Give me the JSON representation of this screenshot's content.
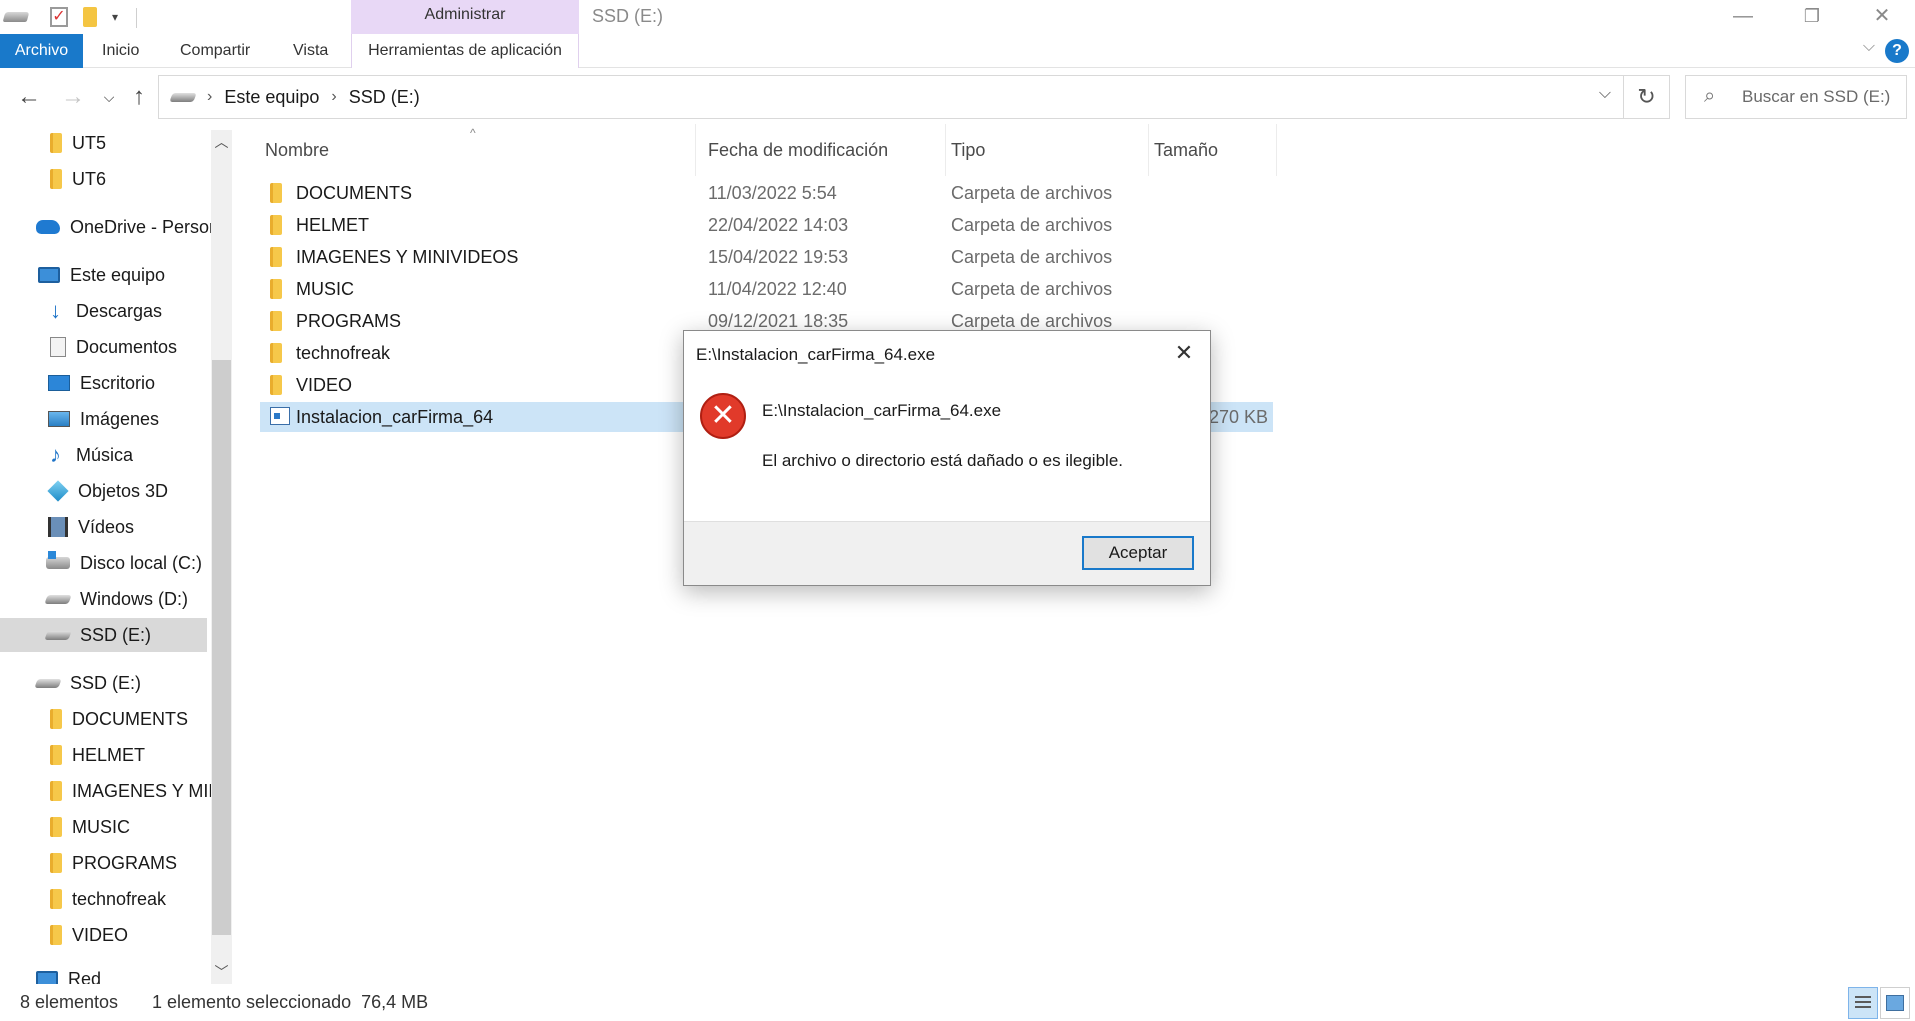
{
  "window": {
    "title": "SSD (E:)",
    "context_group": "Administrar",
    "minimize_icon": "minimize-icon",
    "maximize_icon": "restore-icon",
    "close_icon": "close-icon"
  },
  "ribbon": {
    "tabs": [
      {
        "label": "Archivo"
      },
      {
        "label": "Inicio"
      },
      {
        "label": "Compartir"
      },
      {
        "label": "Vista"
      },
      {
        "label": "Herramientas de aplicación"
      }
    ],
    "help_label": "?"
  },
  "address": {
    "crumbs": [
      "Este equipo",
      "SSD (E:)"
    ],
    "search_placeholder": "Buscar en SSD (E:)"
  },
  "nav": {
    "items": [
      {
        "label": "UT5",
        "icon": "folder-icon"
      },
      {
        "label": "UT6",
        "icon": "folder-icon"
      },
      {
        "label": "OneDrive - Personal",
        "icon": "cloud-icon"
      },
      {
        "label": "Este equipo",
        "icon": "pc-icon"
      },
      {
        "label": "Descargas",
        "icon": "download-icon"
      },
      {
        "label": "Documentos",
        "icon": "documents-icon"
      },
      {
        "label": "Escritorio",
        "icon": "desktop-icon"
      },
      {
        "label": "Imágenes",
        "icon": "images-icon"
      },
      {
        "label": "Música",
        "icon": "music-icon"
      },
      {
        "label": "Objetos 3D",
        "icon": "cube-icon"
      },
      {
        "label": "Vídeos",
        "icon": "video-icon"
      },
      {
        "label": "Disco local (C:)",
        "icon": "local-disk-icon"
      },
      {
        "label": "Windows (D:)",
        "icon": "drive-icon"
      },
      {
        "label": "SSD (E:)",
        "icon": "drive-icon"
      },
      {
        "label": "SSD (E:)",
        "icon": "drive-icon"
      },
      {
        "label": "DOCUMENTS",
        "icon": "folder-icon"
      },
      {
        "label": "HELMET",
        "icon": "folder-icon"
      },
      {
        "label": "IMAGENES Y MINIVIDEOS",
        "icon": "folder-icon"
      },
      {
        "label": "MUSIC",
        "icon": "folder-icon"
      },
      {
        "label": "PROGRAMS",
        "icon": "folder-icon"
      },
      {
        "label": "technofreak",
        "icon": "folder-icon"
      },
      {
        "label": "VIDEO",
        "icon": "folder-icon"
      },
      {
        "label": "Red",
        "icon": "network-icon"
      }
    ],
    "selected_index": 13
  },
  "files": {
    "columns": [
      "Nombre",
      "Fecha de modificación",
      "Tipo",
      "Tamaño"
    ],
    "rows": [
      {
        "name": "DOCUMENTS",
        "date": "11/03/2022 5:54",
        "type": "Carpeta de archivos",
        "size": "",
        "icon": "folder-icon"
      },
      {
        "name": "HELMET",
        "date": "22/04/2022 14:03",
        "type": "Carpeta de archivos",
        "size": "",
        "icon": "folder-icon"
      },
      {
        "name": "IMAGENES Y MINIVIDEOS",
        "date": "15/04/2022 19:53",
        "type": "Carpeta de archivos",
        "size": "",
        "icon": "folder-icon"
      },
      {
        "name": "MUSIC",
        "date": "11/04/2022 12:40",
        "type": "Carpeta de archivos",
        "size": "",
        "icon": "folder-icon"
      },
      {
        "name": "PROGRAMS",
        "date": "09/12/2021 18:35",
        "type": "Carpeta de archivos",
        "size": "",
        "icon": "folder-icon"
      },
      {
        "name": "technofreak",
        "date": "",
        "type": "",
        "size": "",
        "icon": "folder-icon"
      },
      {
        "name": "VIDEO",
        "date": "",
        "type": "",
        "size": "",
        "icon": "folder-icon"
      },
      {
        "name": "Instalacion_carFirma_64",
        "date": "",
        "type": "",
        "size": "270 KB",
        "icon": "exe-icon"
      }
    ],
    "selected_index": 7
  },
  "status": {
    "count": "8 elementos",
    "selection": "1 elemento seleccionado  76,4 MB"
  },
  "dialog": {
    "title": "E:\\Instalacion_carFirma_64.exe",
    "message_path": "E:\\Instalacion_carFirma_64.exe",
    "message": "El archivo o directorio está dañado o es ilegible.",
    "ok_label": "Aceptar",
    "icon": "error-icon"
  },
  "colors": {
    "accent": "#1979ca",
    "context_tab": "#e8d8f6",
    "selection": "#cce4f7",
    "error": "#e13a2a"
  }
}
